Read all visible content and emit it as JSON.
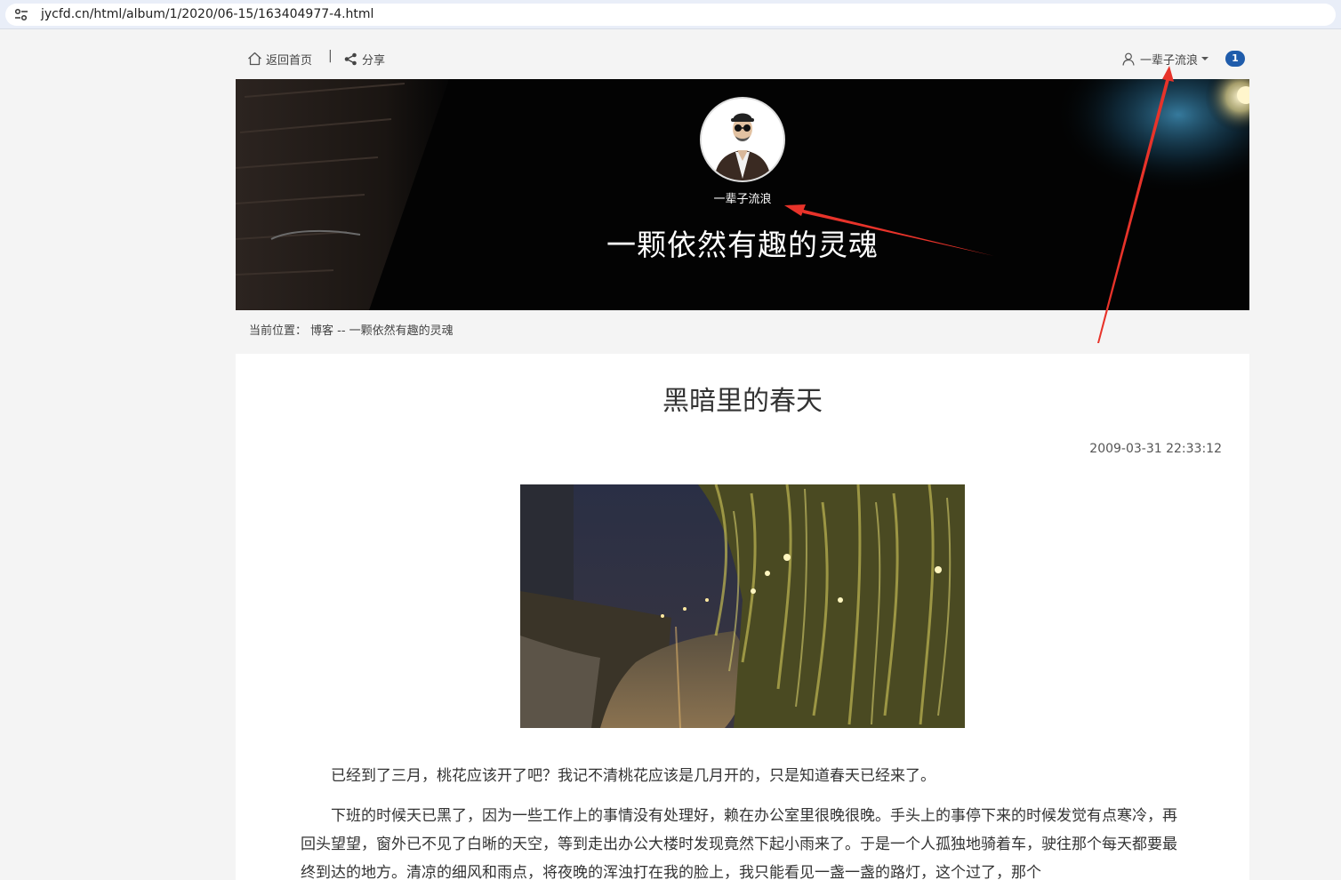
{
  "browser": {
    "url": "jycfd.cn/html/album/1/2020/06-15/163404977-4.html",
    "site_info_icon": "tune-icon"
  },
  "nav": {
    "home_label": "返回首页",
    "separator": "|",
    "share_label": "分享",
    "user_label": "一辈子流浪",
    "badge_count": "1",
    "accent_color": "#1f5cab"
  },
  "banner": {
    "author_name": "一辈子流浪",
    "blog_title": "一颗依然有趣的灵魂"
  },
  "breadcrumb": {
    "prefix": "当前位置：",
    "path": "博客 -- 一颗依然有趣的灵魂"
  },
  "article": {
    "title": "黑暗里的春天",
    "date": "2009-03-31 22:33:12",
    "paragraphs": [
      "已经到了三月，桃花应该开了吧？我记不清桃花应该是几月开的，只是知道春天已经来了。",
      "下班的时候天已黑了，因为一些工作上的事情没有处理好，赖在办公室里很晚很晚。手头上的事停下来的时候发觉有点寒冷，再回头望望，窗外已不见了白晰的天空，等到走出办公大楼时发现竟然下起小雨来了。于是一个人孤独地骑着车，驶往那个每天都要最终到达的地方。清凉的细风和雨点，将夜晚的浑浊打在我的脸上，我只能看见一盏一盏的路灯，这个过了，那个"
    ]
  },
  "annotation_color": "#e8332a"
}
